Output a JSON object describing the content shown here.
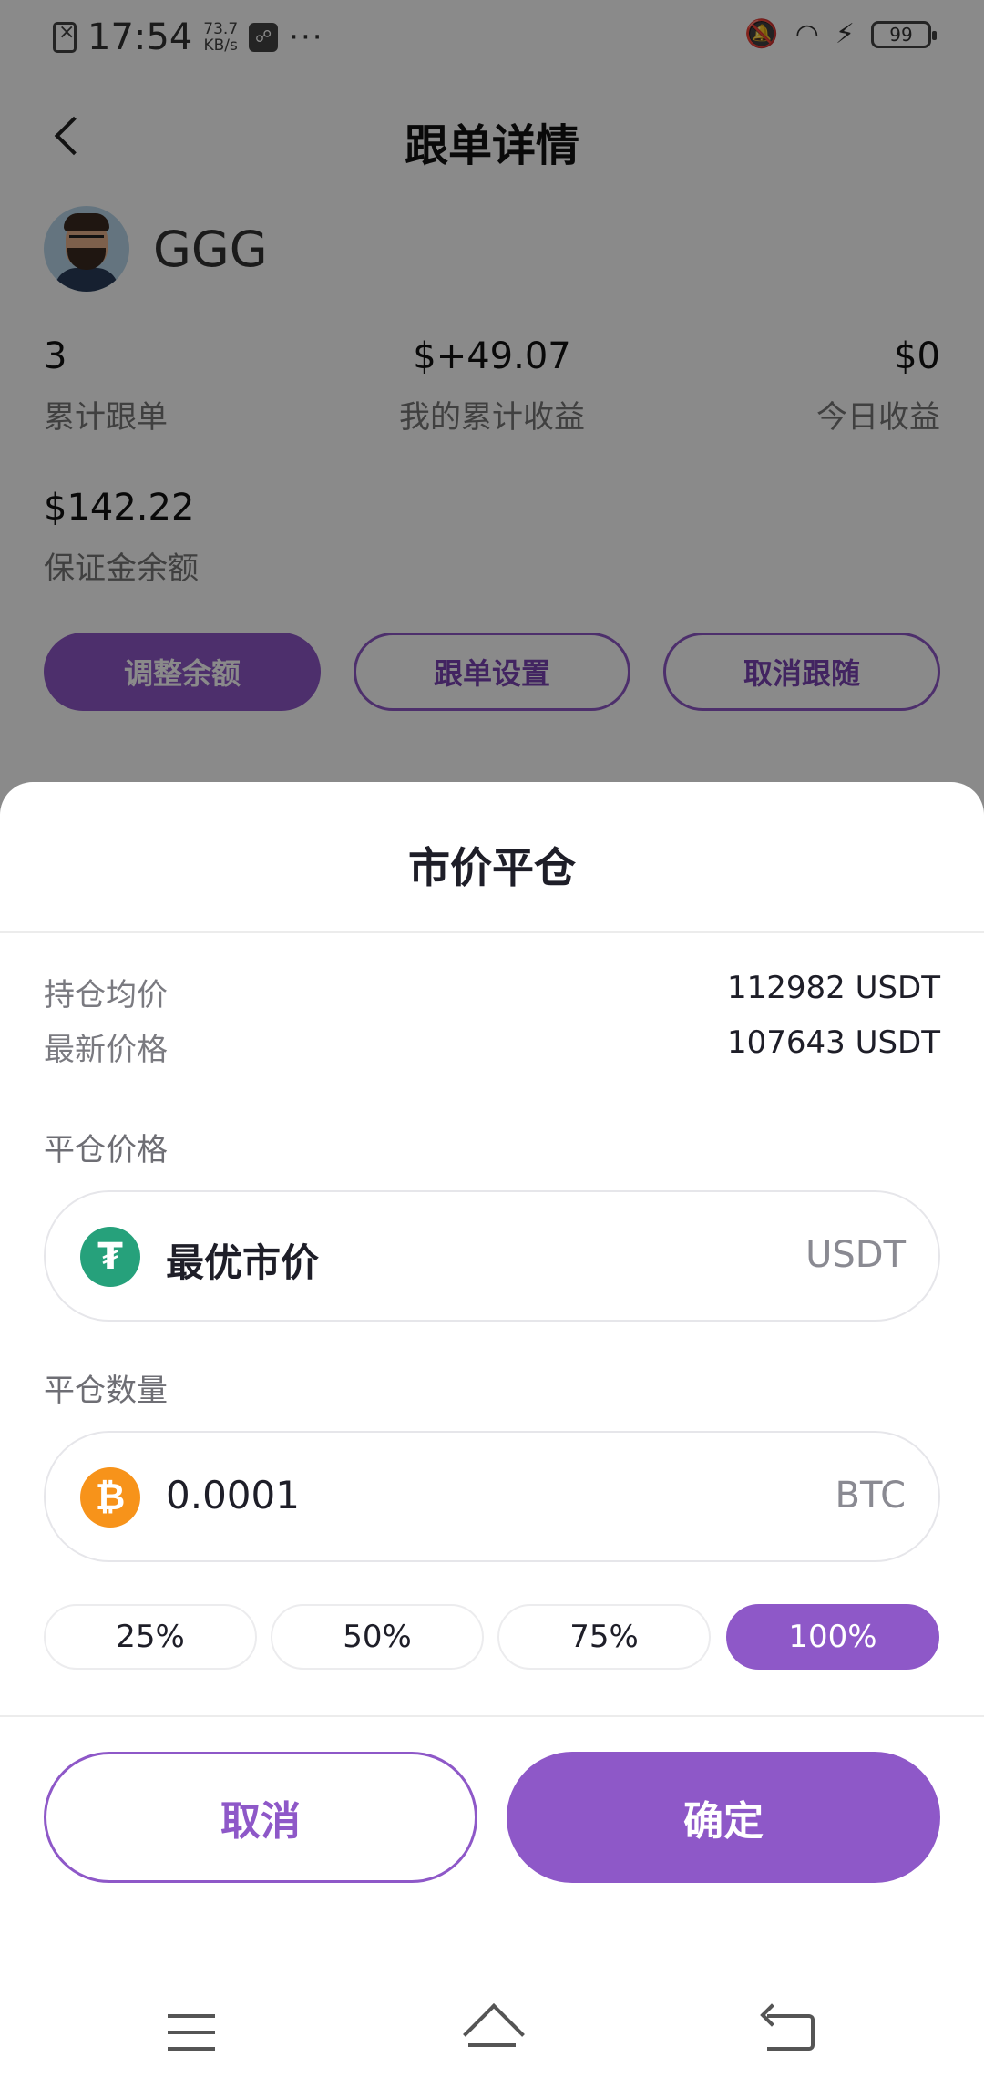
{
  "status_bar": {
    "time": "17:54",
    "speed": "73.7",
    "speed_unit": "KB/s",
    "dots": "···",
    "battery": "99"
  },
  "header": {
    "title": "跟单详情"
  },
  "profile": {
    "name": "GGG"
  },
  "stats": {
    "total_orders_value": "3",
    "total_orders_label": "累计跟单",
    "total_profit_value": "$+49.07",
    "total_profit_label": "我的累计收益",
    "today_profit_value": "$0",
    "today_profit_label": "今日收益"
  },
  "margin": {
    "value": "$142.22",
    "label": "保证金余额"
  },
  "actions": {
    "adjust_balance": "调整余额",
    "copy_settings": "跟单设置",
    "unfollow": "取消跟随"
  },
  "sheet": {
    "title": "市价平仓",
    "avg_position_price_label": "持仓均价",
    "avg_position_price_value": "112982 USDT",
    "latest_price_label": "最新价格",
    "latest_price_value": "107643 USDT",
    "close_price_label": "平仓价格",
    "close_price_value": "最优市价",
    "close_price_unit": "USDT",
    "close_qty_label": "平仓数量",
    "close_qty_value": "0.0001",
    "close_qty_unit": "BTC",
    "percent_options": [
      "25%",
      "50%",
      "75%",
      "100%"
    ],
    "selected_percent": "100%",
    "cancel_label": "取消",
    "confirm_label": "确定"
  },
  "colors": {
    "accent": "#8e58c8",
    "usdt": "#26a17b",
    "btc": "#f7931a"
  },
  "icons": {
    "back": "chevron-left-icon",
    "usdt": "tether-icon",
    "btc": "bitcoin-icon",
    "nav_menu": "menu-icon",
    "nav_home": "home-icon",
    "nav_back": "back-icon"
  }
}
